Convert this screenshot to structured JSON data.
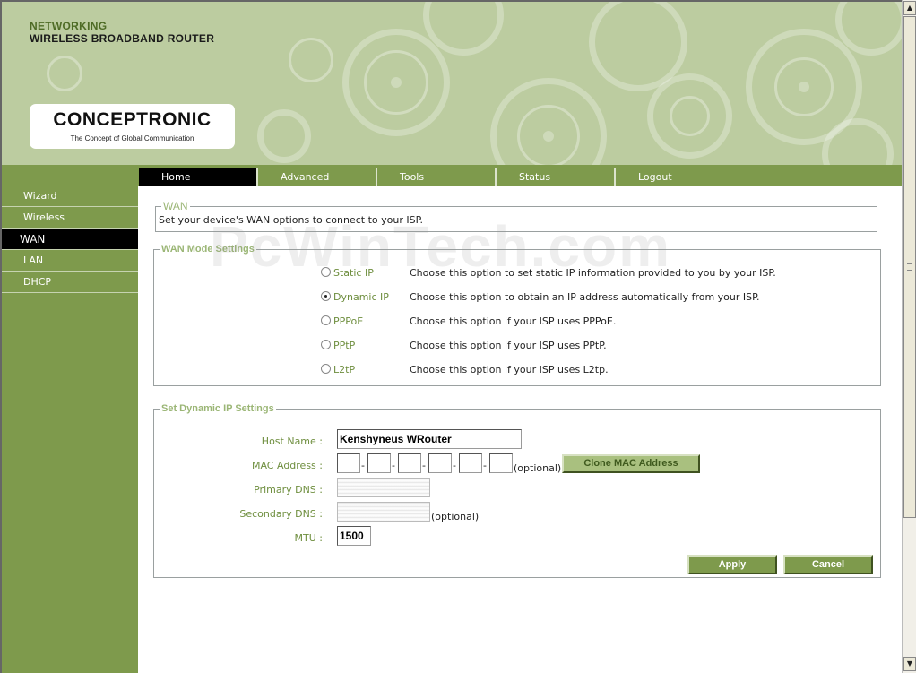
{
  "header": {
    "brand_line1": "NETWORKING",
    "brand_line2": "WIRELESS BROADBAND ROUTER",
    "logo_name": "CONCEPTRONIC",
    "logo_tagline": "The Concept of Global Communication"
  },
  "tabs": [
    {
      "label": "Home",
      "active": true
    },
    {
      "label": "Advanced",
      "active": false
    },
    {
      "label": "Tools",
      "active": false
    },
    {
      "label": "Status",
      "active": false
    },
    {
      "label": "Logout",
      "active": false
    }
  ],
  "sidebar": {
    "items": [
      {
        "label": "Wizard",
        "active": false
      },
      {
        "label": "Wireless",
        "active": false
      },
      {
        "label": "WAN",
        "active": true
      },
      {
        "label": "LAN",
        "active": false
      },
      {
        "label": "DHCP",
        "active": false
      }
    ]
  },
  "wan": {
    "legend": "WAN",
    "description": "Set your device's WAN options to connect to your ISP."
  },
  "mode_settings": {
    "legend": "WAN Mode Settings",
    "selected": "Dynamic IP",
    "modes": [
      {
        "label": "Static IP",
        "description": "Choose this option to set static IP information provided to you by your ISP.",
        "checked": false
      },
      {
        "label": "Dynamic IP",
        "description": "Choose this option to obtain an IP address automatically from your ISP.",
        "checked": true
      },
      {
        "label": "PPPoE",
        "description": "Choose this option if your ISP uses PPPoE.",
        "checked": false
      },
      {
        "label": "PPtP",
        "description": "Choose this option if your ISP uses PPtP.",
        "checked": false
      },
      {
        "label": "L2tP",
        "description": "Choose this option if your ISP uses L2tp.",
        "checked": false
      }
    ]
  },
  "dynamic_ip": {
    "legend": "Set Dynamic IP Settings",
    "host_name_label": "Host Name :",
    "host_name_value": "Kenshyneus WRouter",
    "mac_label": "MAC Address :",
    "mac_separator": "-",
    "mac_optional": "(optional)",
    "clone_mac_button": "Clone MAC Address",
    "primary_dns_label": "Primary DNS :",
    "secondary_dns_label": "Secondary DNS :",
    "secondary_optional": "(optional)",
    "mtu_label": "MTU :",
    "mtu_value": "1500",
    "apply_button": "Apply",
    "cancel_button": "Cancel"
  },
  "watermark": "PcWinTech.com",
  "colors": {
    "header_bg": "#bccca0",
    "sidebar_bg": "#7e9a4c",
    "accent_text": "#6e8e3e",
    "legend_text": "#9bb676",
    "active_bg": "#000000"
  },
  "icons": {
    "scroll_up": "scroll-up-arrow-icon",
    "scroll_down": "scroll-down-arrow-icon"
  }
}
